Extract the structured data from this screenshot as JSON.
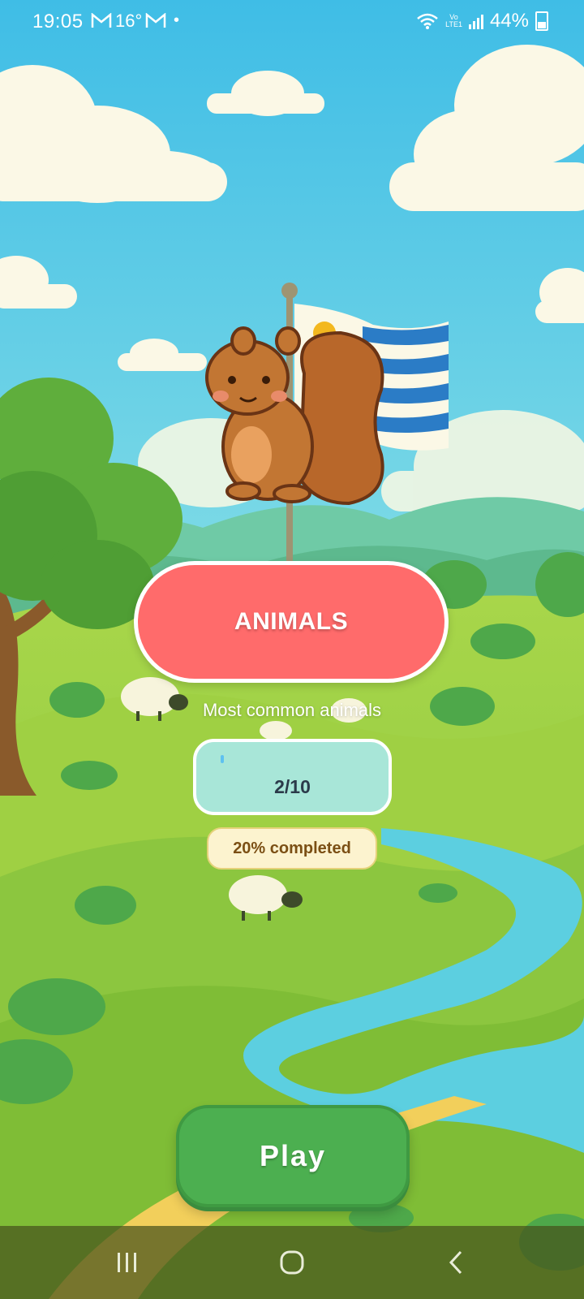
{
  "status_bar": {
    "time": "19:05",
    "temperature": "16°",
    "battery": "44%",
    "icons": [
      "gmail-icon",
      "gmail-icon",
      "notification-dot",
      "wifi-icon",
      "volte-icon",
      "signal-icon",
      "battery-icon"
    ],
    "volte_label_top": "Vo",
    "volte_label_bottom": "LTE1"
  },
  "category": {
    "title": "ANIMALS",
    "subtitle": "Most common animals",
    "progress_text": "2/10",
    "progress_value": 0.2,
    "completed_text": "20% completed",
    "color": "#ff6b6b"
  },
  "play_button": {
    "label": "Play",
    "color": "#4caf50"
  },
  "mascot": {
    "icon": "squirrel-icon",
    "flag_icon": "uruguay-flag-icon"
  },
  "nav_bar": {
    "icons": [
      "recent-apps-icon",
      "home-icon",
      "back-icon"
    ]
  },
  "colors": {
    "sky": "#4fc4e8",
    "grass": "#8cc63f",
    "river": "#5ccfe0",
    "progress": "#a8e6d8",
    "badge": "#fcf3cf"
  }
}
